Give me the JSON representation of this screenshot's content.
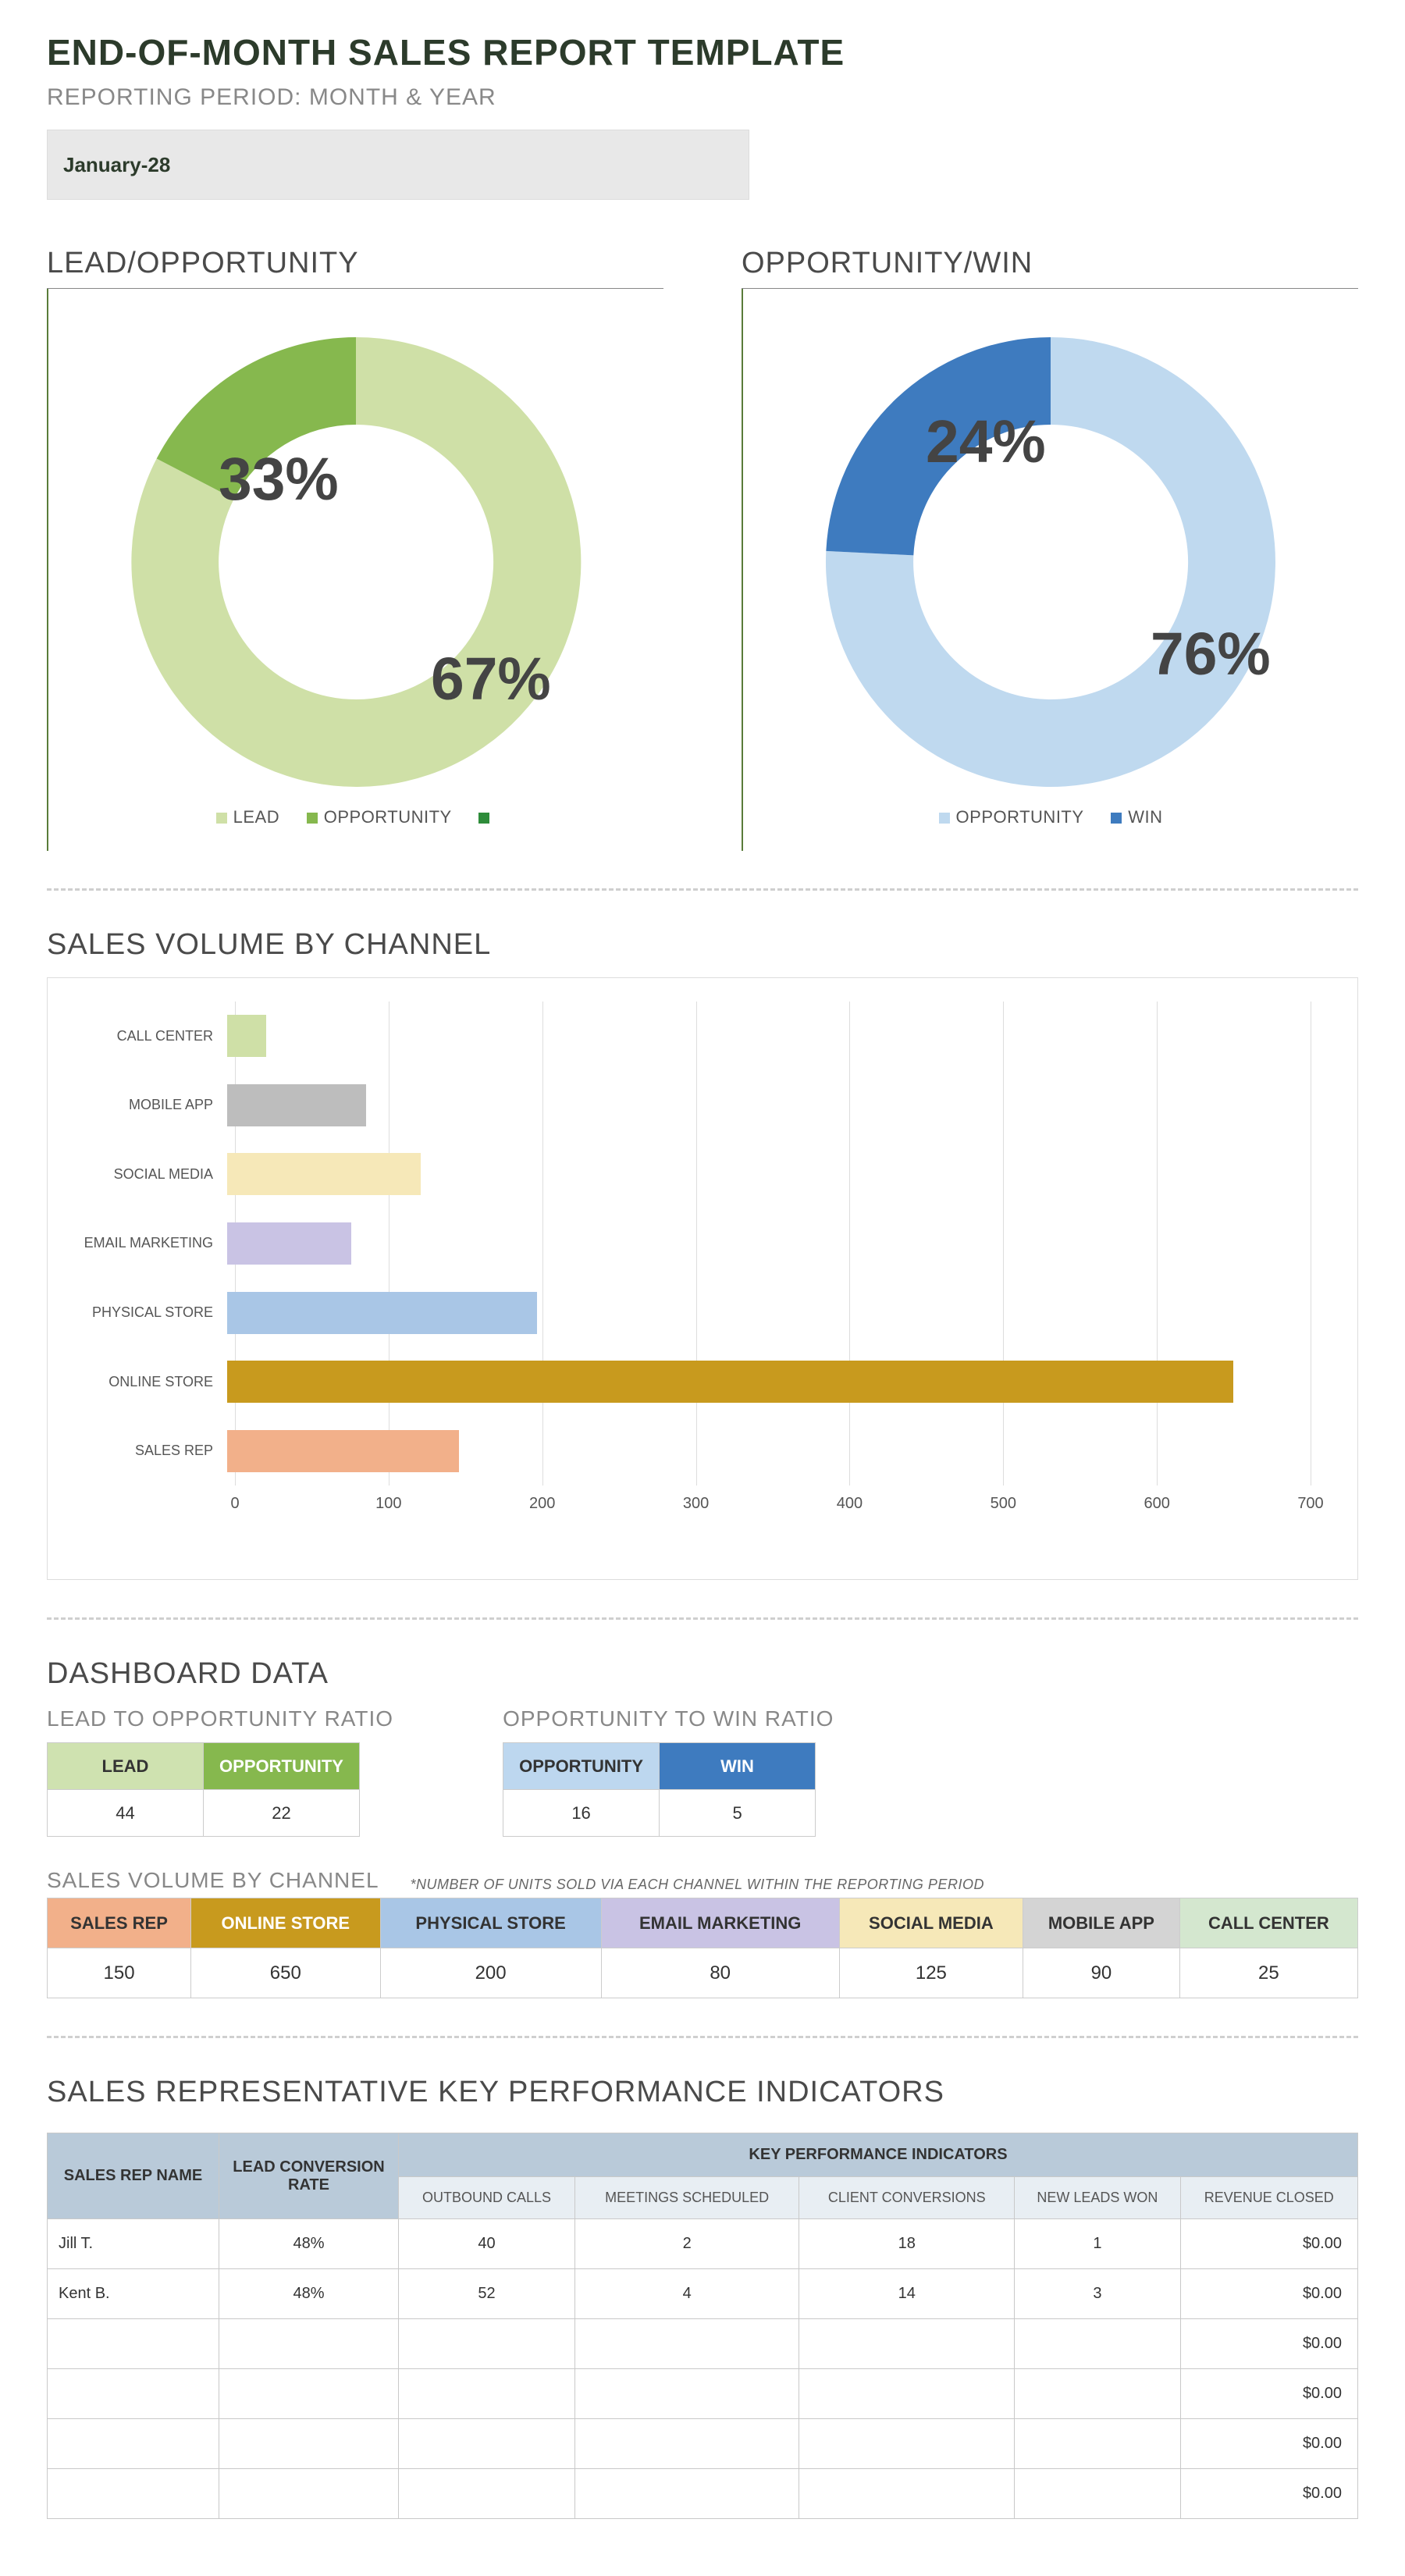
{
  "header": {
    "title": "END-OF-MONTH SALES REPORT TEMPLATE",
    "subtitle": "REPORTING PERIOD: MONTH & YEAR",
    "period_value": "January-28"
  },
  "donut_titles": {
    "left": "LEAD/OPPORTUNITY",
    "right": "OPPORTUNITY/WIN"
  },
  "donut_left": {
    "slice_a": {
      "label": "LEAD",
      "pct": "67%",
      "color": "#cfe0a7"
    },
    "slice_b": {
      "label": "OPPORTUNITY",
      "pct": "33%",
      "color": "#86b84e"
    },
    "extra_legend_color": "#2e8c3a"
  },
  "donut_right": {
    "slice_a": {
      "label": "OPPORTUNITY",
      "pct": "76%",
      "color": "#bfd9ef"
    },
    "slice_b": {
      "label": "WIN",
      "pct": "24%",
      "color": "#3e7bbf"
    }
  },
  "bar_section": {
    "title": "SALES VOLUME BY CHANNEL"
  },
  "bar_colors": {
    "SALES REP": "#f2b08a",
    "ONLINE STORE": "#c89a1e",
    "PHYSICAL STORE": "#a9c6e6",
    "EMAIL MARKETING": "#c9c3e4",
    "SOCIAL MEDIA": "#f6e8b8",
    "MOBILE APP": "#bdbdbd",
    "CALL CENTER": "#cfe0a7"
  },
  "bar_xticks": [
    "0",
    "100",
    "200",
    "300",
    "400",
    "500",
    "600",
    "700"
  ],
  "dashboard": {
    "title": "DASHBOARD DATA",
    "lead_ratio": {
      "title": "LEAD TO OPPORTUNITY RATIO",
      "h1": "LEAD",
      "h2": "OPPORTUNITY",
      "v1": "44",
      "v2": "22"
    },
    "win_ratio": {
      "title": "OPPORTUNITY TO WIN RATIO",
      "h1": "OPPORTUNITY",
      "h2": "WIN",
      "v1": "16",
      "v2": "5"
    }
  },
  "svc": {
    "title": "SALES VOLUME BY CHANNEL",
    "note": "*NUMBER OF UNITS SOLD VIA EACH CHANNEL WITHIN THE REPORTING PERIOD"
  },
  "svc_headers": [
    "SALES REP",
    "ONLINE STORE",
    "PHYSICAL STORE",
    "EMAIL MARKETING",
    "SOCIAL MEDIA",
    "MOBILE APP",
    "CALL CENTER"
  ],
  "svc_colors": [
    "#f2b08a",
    "#c89a1e",
    "#a9c6e6",
    "#c9c3e4",
    "#f6e8b8",
    "#d4d4d4",
    "#d4e7cf"
  ],
  "svc_values": [
    "150",
    "650",
    "200",
    "80",
    "125",
    "90",
    "25"
  ],
  "kpi": {
    "title": "SALES REPRESENTATIVE KEY PERFORMANCE INDICATORS",
    "col_rep": "SALES REP NAME",
    "col_conv": "LEAD CONVERSION RATE",
    "col_group": "KEY PERFORMANCE INDICATORS",
    "sub": [
      "OUTBOUND CALLS",
      "MEETINGS SCHEDULED",
      "CLIENT CONVERSIONS",
      "NEW LEADS WON",
      "REVENUE CLOSED"
    ],
    "rows": [
      {
        "name": "Jill T.",
        "conv": "48%",
        "c1": "40",
        "c2": "2",
        "c3": "18",
        "c4": "1",
        "rev": "$0.00"
      },
      {
        "name": "Kent B.",
        "conv": "48%",
        "c1": "52",
        "c2": "4",
        "c3": "14",
        "c4": "3",
        "rev": "$0.00"
      },
      {
        "name": "",
        "conv": "",
        "c1": "",
        "c2": "",
        "c3": "",
        "c4": "",
        "rev": "$0.00"
      },
      {
        "name": "",
        "conv": "",
        "c1": "",
        "c2": "",
        "c3": "",
        "c4": "",
        "rev": "$0.00"
      },
      {
        "name": "",
        "conv": "",
        "c1": "",
        "c2": "",
        "c3": "",
        "c4": "",
        "rev": "$0.00"
      },
      {
        "name": "",
        "conv": "",
        "c1": "",
        "c2": "",
        "c3": "",
        "c4": "",
        "rev": "$0.00"
      }
    ]
  },
  "chart_data": [
    {
      "type": "pie",
      "title": "LEAD/OPPORTUNITY",
      "series": [
        {
          "name": "LEAD",
          "value": 67,
          "color": "#cfe0a7"
        },
        {
          "name": "OPPORTUNITY",
          "value": 33,
          "color": "#86b84e"
        }
      ],
      "donut": true
    },
    {
      "type": "pie",
      "title": "OPPORTUNITY/WIN",
      "series": [
        {
          "name": "OPPORTUNITY",
          "value": 76,
          "color": "#bfd9ef"
        },
        {
          "name": "WIN",
          "value": 24,
          "color": "#3e7bbf"
        }
      ],
      "donut": true
    },
    {
      "type": "bar",
      "orientation": "horizontal",
      "title": "SALES VOLUME BY CHANNEL",
      "categories": [
        "CALL CENTER",
        "MOBILE APP",
        "SOCIAL MEDIA",
        "EMAIL MARKETING",
        "PHYSICAL STORE",
        "ONLINE STORE",
        "SALES REP"
      ],
      "values": [
        25,
        90,
        125,
        80,
        200,
        650,
        150
      ],
      "colors": [
        "#cfe0a7",
        "#bdbdbd",
        "#f6e8b8",
        "#c9c3e4",
        "#a9c6e6",
        "#c89a1e",
        "#f2b08a"
      ],
      "xlim": [
        0,
        700
      ],
      "xticks": [
        0,
        100,
        200,
        300,
        400,
        500,
        600,
        700
      ]
    }
  ]
}
